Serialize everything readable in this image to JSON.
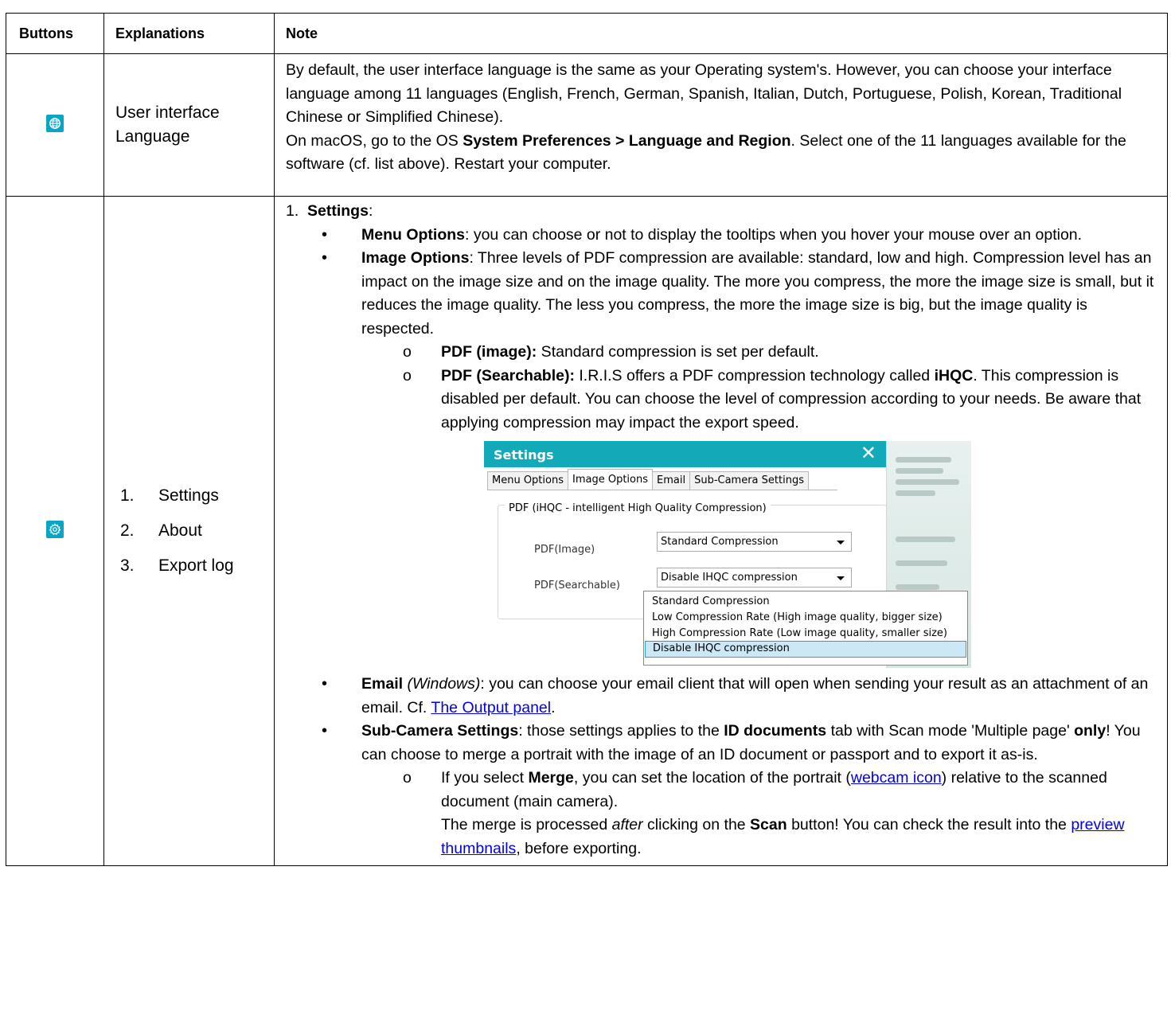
{
  "headers": {
    "buttons": "Buttons",
    "explanations": "Explanations",
    "note": "Note"
  },
  "row1": {
    "icon": "globe-icon",
    "explanation": "User interface Language",
    "note_p1": "By default, the user interface language is the same as your Operating system's. However, you can choose your interface language among 11 languages (English, French, German, Spanish, Italian, Dutch, Portuguese, Polish, Korean, Traditional Chinese or Simplified Chinese).",
    "note_p2_a": "On macOS, go to the OS ",
    "note_p2_b": "System Preferences > Language and Region",
    "note_p2_c": ". Select one of the 11 languages available for the software (cf. list above). Restart your computer."
  },
  "row2": {
    "icon": "gear-icon",
    "explanations": [
      {
        "num": "1.",
        "label": "Settings"
      },
      {
        "num": "2.",
        "label": "About"
      },
      {
        "num": "3.",
        "label": "Export log"
      }
    ],
    "settings_num": "1.",
    "settings_label": "Settings",
    "settings_colon": ":",
    "menu_options_b": "Menu Options",
    "menu_options_t": ": you can choose or not to display the tooltips when you hover your mouse over an option.",
    "image_options_b": "Image Options",
    "image_options_t": ": Three levels of PDF compression are available: standard, low and high. Compression level has an impact on the image size and on the image quality. The more you compress, the more the image size is small, but it reduces the image quality. The less you compress, the more the image size is big, but the image quality is respected.",
    "pdf_image_b": "PDF (image):",
    "pdf_image_t": " Standard compression is set per default.",
    "pdf_search_b": "PDF (Searchable):",
    "pdf_search_t1": " I.R.I.S offers a PDF compression technology called ",
    "pdf_search_b2": "iHQC",
    "pdf_search_t2": ". This compression is disabled per default. You can choose the level of compression according to your needs. Be aware that applying compression may impact the export speed.",
    "email_b": "Email",
    "email_i": " (Windows)",
    "email_t": ": you can choose your email client that will open when sending your result as an attachment of an email. Cf. ",
    "email_link": "The Output panel",
    "email_end": ".",
    "sub_b": "Sub-Camera Settings",
    "sub_t1": ": those settings applies to the ",
    "sub_b2": "ID documents",
    "sub_t2": " tab with Scan mode 'Multiple page' ",
    "sub_b3": "only",
    "sub_t3": "! You can choose to merge a portrait with the image of an ID document or passport and to export it as-is.",
    "merge_t1": "If you select ",
    "merge_b": "Merge",
    "merge_t2": ", you can set the location of the portrait (",
    "merge_link": "webcam icon",
    "merge_t3": ") relative to the scanned document (main camera).",
    "merge2_t1": "The merge is processed ",
    "merge2_i": "after",
    "merge2_t2": " clicking on the ",
    "merge2_b": "Scan",
    "merge2_t3": " button! You can check the result into the ",
    "merge2_link": "preview thumbnails",
    "merge2_t4": ", before exporting."
  },
  "screenshot": {
    "title": "Settings",
    "close": "✕",
    "tabs": [
      "Menu Options",
      "Image Options",
      "Email",
      "Sub-Camera Settings"
    ],
    "active_tab": "Image Options",
    "group_label": "PDF (iHQC - intelligent High Quality Compression)",
    "pdf_image_label": "PDF(Image)",
    "pdf_image_value": "Standard Compression",
    "pdf_search_label": "PDF(Searchable)",
    "pdf_search_value": "Disable IHQC compression",
    "options": [
      "Standard Compression",
      "Low Compression Rate (High image quality, bigger size)",
      "High Compression Rate (Low image quality, smaller size)",
      "Disable IHQC compression"
    ],
    "selected_option": "Disable IHQC compression"
  },
  "colors": {
    "icon_bg": "#0aa5c5",
    "window_title_bg": "#12a9b9",
    "link": "#0000ee"
  }
}
